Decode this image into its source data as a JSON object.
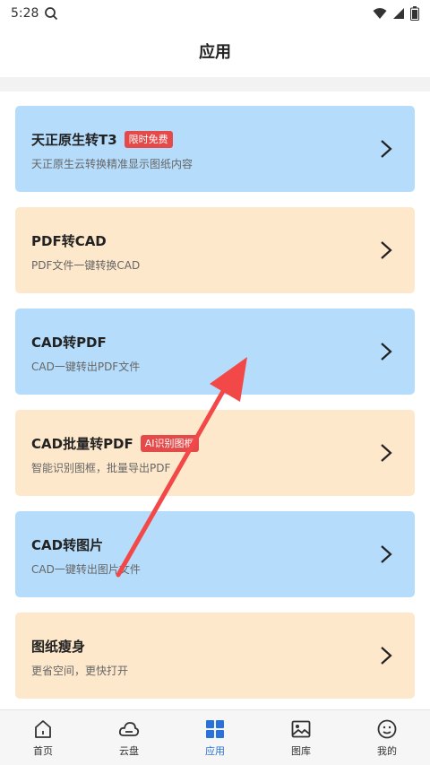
{
  "status_bar": {
    "time": "5:28"
  },
  "header": {
    "title": "应用"
  },
  "cards": [
    {
      "title": "天正原生转T3",
      "badge": "限时免费",
      "subtitle": "天正原生云转换精准显示图纸内容",
      "color": "blue"
    },
    {
      "title": "PDF转CAD",
      "badge": "",
      "subtitle": "PDF文件一键转换CAD",
      "color": "orange"
    },
    {
      "title": "CAD转PDF",
      "badge": "",
      "subtitle": "CAD一键转出PDF文件",
      "color": "blue"
    },
    {
      "title": "CAD批量转PDF",
      "badge": "AI识别图框",
      "subtitle": "智能识别图框，批量导出PDF",
      "color": "orange"
    },
    {
      "title": "CAD转图片",
      "badge": "",
      "subtitle": "CAD一键转出图片文件",
      "color": "blue"
    },
    {
      "title": "图纸瘦身",
      "badge": "",
      "subtitle": "更省空间，更快打开",
      "color": "orange"
    }
  ],
  "bottom_nav": [
    {
      "label": "首页",
      "icon": "home-icon"
    },
    {
      "label": "云盘",
      "icon": "cloud-icon"
    },
    {
      "label": "应用",
      "icon": "apps-grid-icon",
      "active": true
    },
    {
      "label": "图库",
      "icon": "gallery-icon"
    },
    {
      "label": "我的",
      "icon": "profile-icon"
    }
  ],
  "colors": {
    "card_blue": "#b5dcfb",
    "card_orange": "#fee8cb",
    "badge_red": "#e54a4a",
    "active_nav": "#2a72d8",
    "arrow_red": "#f24848"
  }
}
